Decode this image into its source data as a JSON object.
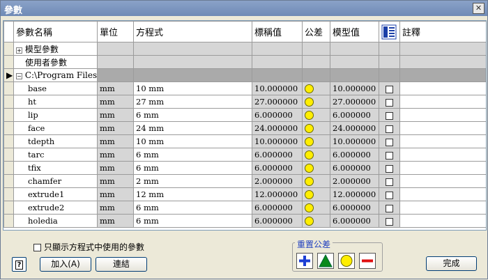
{
  "window": {
    "title": "參數",
    "close_glyph": "✕"
  },
  "columns": {
    "name": "參數名稱",
    "unit": "單位",
    "equation": "方程式",
    "nominal": "標稱值",
    "tolerance": "公差",
    "model_value": "模型值",
    "export": "",
    "comment": "註釋"
  },
  "groups": {
    "model_params": "模型參數",
    "user_params": "使用者參數",
    "path": "C:\\Program Files\\…"
  },
  "params": [
    {
      "name": "base",
      "unit": "mm",
      "equation": "10 mm",
      "nominal": "10.000000",
      "model": "10.000000"
    },
    {
      "name": "ht",
      "unit": "mm",
      "equation": "27 mm",
      "nominal": "27.000000",
      "model": "27.000000"
    },
    {
      "name": "lip",
      "unit": "mm",
      "equation": "6 mm",
      "nominal": "6.000000",
      "model": "6.000000"
    },
    {
      "name": "face",
      "unit": "mm",
      "equation": "24 mm",
      "nominal": "24.000000",
      "model": "24.000000"
    },
    {
      "name": "tdepth",
      "unit": "mm",
      "equation": "10 mm",
      "nominal": "10.000000",
      "model": "10.000000"
    },
    {
      "name": "tarc",
      "unit": "mm",
      "equation": "6 mm",
      "nominal": "6.000000",
      "model": "6.000000"
    },
    {
      "name": "tfix",
      "unit": "mm",
      "equation": "6 mm",
      "nominal": "6.000000",
      "model": "6.000000"
    },
    {
      "name": "chamfer",
      "unit": "mm",
      "equation": "2 mm",
      "nominal": "2.000000",
      "model": "2.000000"
    },
    {
      "name": "extrude1",
      "unit": "mm",
      "equation": "12 mm",
      "nominal": "12.000000",
      "model": "12.000000"
    },
    {
      "name": "extrude2",
      "unit": "mm",
      "equation": "6 mm",
      "nominal": "6.000000",
      "model": "6.000000"
    },
    {
      "name": "holedia",
      "unit": "mm",
      "equation": "6 mm",
      "nominal": "6.000000",
      "model": "6.000000"
    }
  ],
  "footer": {
    "filter_label": "只顯示方程式中使用的參數",
    "help_label": "?",
    "add_label": "加入(A)",
    "link_label": "連結",
    "reset_tol_label": "重置公差",
    "done_label": "完成"
  },
  "colors": {
    "tol_yellow": "#ffee00",
    "tool_blue": "#1c3fd4",
    "tool_green": "#0a8a1a",
    "tool_red": "#e01010"
  }
}
